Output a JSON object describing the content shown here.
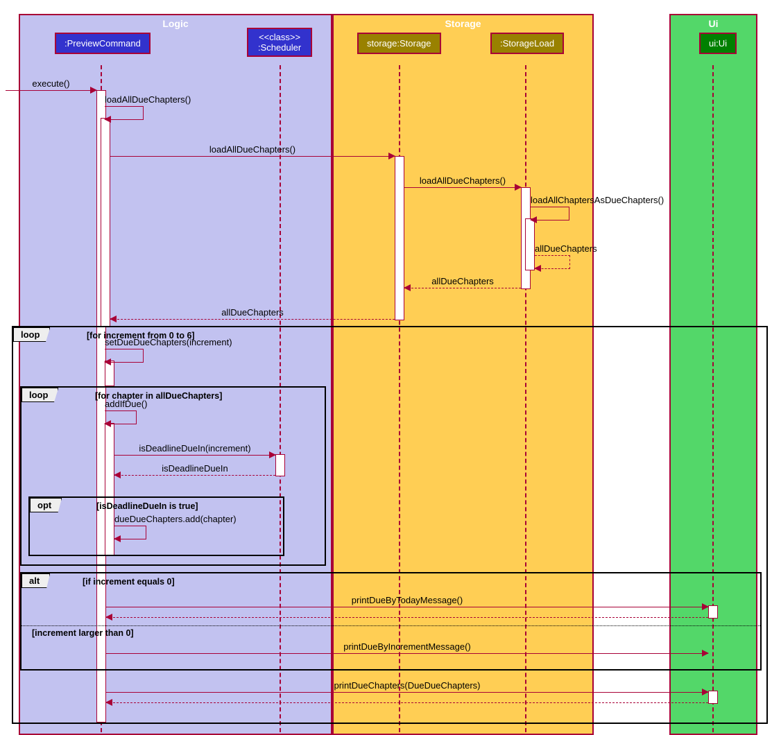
{
  "regions": {
    "logic": "Logic",
    "storage": "Storage",
    "ui": "Ui"
  },
  "participants": {
    "preview": ":PreviewCommand",
    "scheduler_stereo": "<<class>>",
    "scheduler": ":Scheduler",
    "storage": "storage:Storage",
    "load": ":StorageLoad",
    "ui": "ui:Ui"
  },
  "messages": {
    "execute": "execute()",
    "loadAllDueChapters": "loadAllDueChapters()",
    "loadAllChaptersAsDueChapters": "loadAllChaptersAsDueChapters()",
    "allDueChapters": "allDueChapters",
    "setDueDueChapters": "setDueDueChapters(increment)",
    "addIfDue": "addIfDue()",
    "isDeadlineDueIn": "isDeadlineDueIn(increment)",
    "isDeadlineDueInRet": "isDeadlineDueIn",
    "dueAdd": "dueDueChapters.add(chapter)",
    "printToday": "printDueByTodayMessage()",
    "printIncrement": "printDueByIncrementMessage()",
    "printChapters": "printDueChapters(DueDueChapters)"
  },
  "frames": {
    "loopOuter": {
      "op": "loop",
      "guard": "[for increment from 0 to 6]"
    },
    "loopInner": {
      "op": "loop",
      "guard": "[for chapter in allDueChapters]"
    },
    "opt": {
      "op": "opt",
      "guard": "[isDeadlineDueIn is true]"
    },
    "alt": {
      "op": "alt",
      "guard1": "[if increment equals 0]",
      "guard2": "[increment larger than 0]"
    }
  }
}
